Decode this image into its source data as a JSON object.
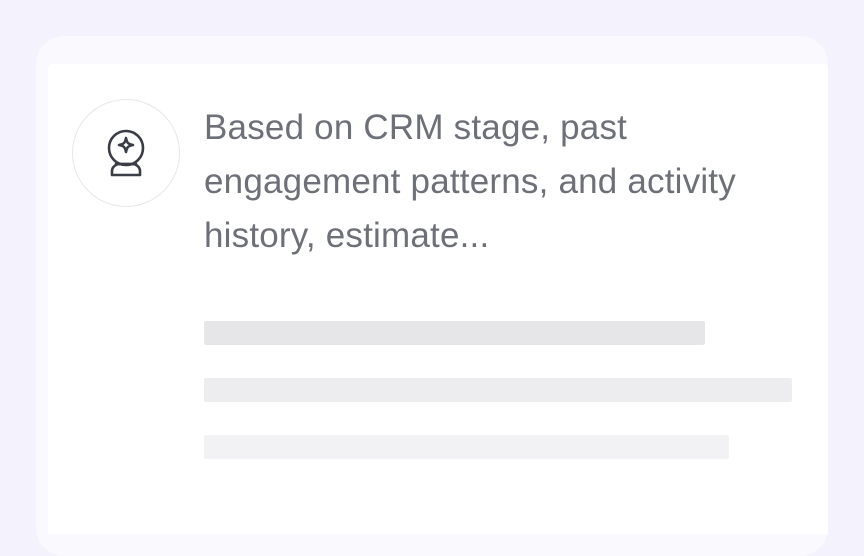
{
  "assistant": {
    "icon": "crystal-ball-icon",
    "prompt": "Based on CRM stage, past engagement patterns, and activity history, estimate..."
  },
  "loading": {
    "state": "generating",
    "placeholder_lines": 3
  },
  "colors": {
    "page_background": "#f4f3fd",
    "card_background": "#ffffff",
    "text": "#6e7078",
    "icon_stroke": "#3b3d45",
    "skeleton": "#e6e6e8"
  }
}
